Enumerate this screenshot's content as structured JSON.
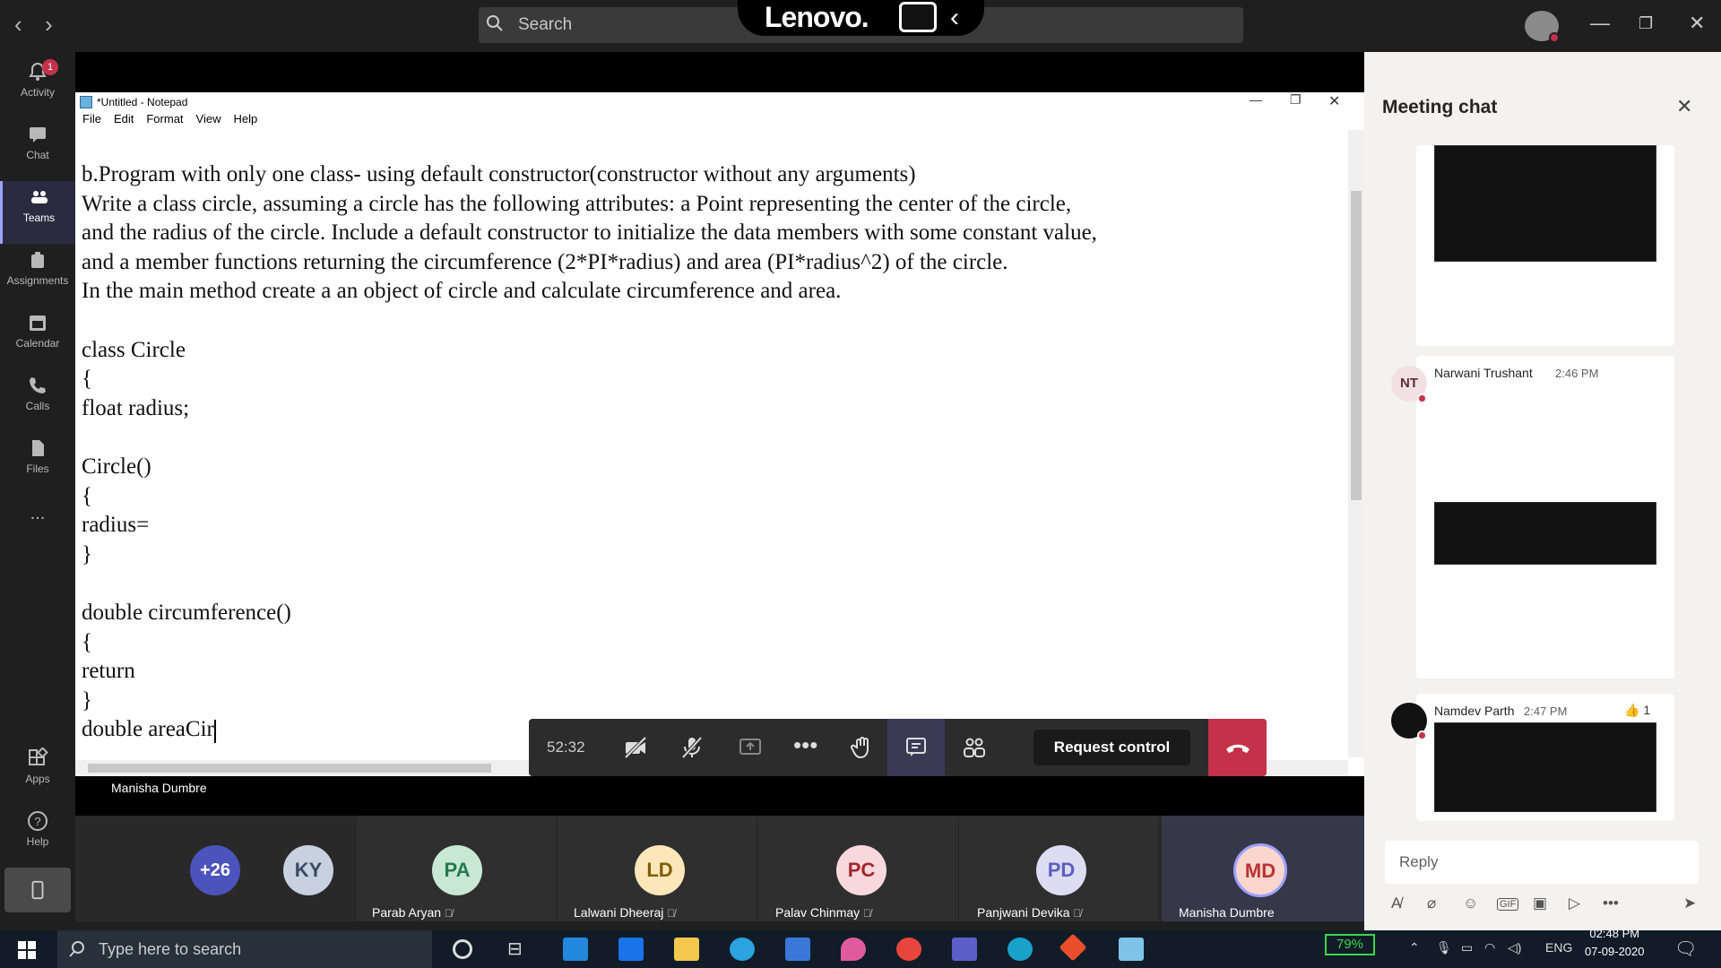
{
  "teams": {
    "search_placeholder": "Search",
    "lenovo_brand": "Lenovo.",
    "rail": [
      {
        "label": "Activity",
        "icon": "bell-icon",
        "badge": "1"
      },
      {
        "label": "Chat",
        "icon": "chat-icon"
      },
      {
        "label": "Teams",
        "icon": "teams-icon"
      },
      {
        "label": "Assignments",
        "icon": "assignments-icon"
      },
      {
        "label": "Calendar",
        "icon": "calendar-icon"
      },
      {
        "label": "Calls",
        "icon": "phone-icon"
      },
      {
        "label": "Files",
        "icon": "files-icon"
      },
      {
        "label": "...",
        "icon": "more-icon"
      },
      {
        "label": "Apps",
        "icon": "apps-icon"
      },
      {
        "label": "Help",
        "icon": "help-icon"
      }
    ]
  },
  "notepad": {
    "title": "*Untitled - Notepad",
    "menu": [
      "File",
      "Edit",
      "Format",
      "View",
      "Help"
    ],
    "lines": [
      "b.Program with only one class- using default constructor(constructor without any arguments)",
      "Write a class circle, assuming a circle has the following attributes: a Point representing the center of the circle,",
      "and the radius of the circle. Include a default constructor to initialize the data members with some constant value,",
      "and a member functions returning the circumference (2*PI*radius) and area (PI*radius^2) of the circle.",
      "In the main method create a an object of circle and calculate circumference and area.",
      "",
      "class Circle",
      "{",
      "float radius;",
      "",
      "Circle()",
      "{",
      "radius=",
      "}",
      "",
      "double circumference()",
      "{",
      "return",
      "}",
      "double areaCir"
    ]
  },
  "call": {
    "timer": "52:32",
    "request_control": "Request control",
    "presenter": "Manisha Dumbre"
  },
  "participants": [
    {
      "initials": "+26",
      "name": "",
      "color": "#4b53bc"
    },
    {
      "initials": "KY",
      "name": "",
      "color": "#c8d1df"
    },
    {
      "initials": "PA",
      "name": "Parab Aryan",
      "color": "#c9e8d4"
    },
    {
      "initials": "LD",
      "name": "Lalwani Dheeraj",
      "color": "#fbe7b9"
    },
    {
      "initials": "PC",
      "name": "Palav Chinmay",
      "color": "#f9d8dd"
    },
    {
      "initials": "PD",
      "name": "Panjwani Devika",
      "color": "#dedcf0"
    },
    {
      "initials": "MD",
      "name": "Manisha Dumbre",
      "color": "#fbd6cc"
    }
  ],
  "chat": {
    "title": "Meeting chat",
    "messages": [
      {
        "sender": "",
        "time": "",
        "initials": ""
      },
      {
        "sender": "Narwani Trushant",
        "time": "2:46 PM",
        "initials": "NT"
      },
      {
        "sender": "Namdev Parth",
        "time": "2:47 PM",
        "initials": "",
        "reaction": "👍 1"
      }
    ],
    "reply_placeholder": "Reply"
  },
  "taskbar": {
    "search_placeholder": "Type here to search",
    "battery": "79%",
    "language": "ENG",
    "time": "02:48 PM",
    "date": "07-09-2020"
  }
}
